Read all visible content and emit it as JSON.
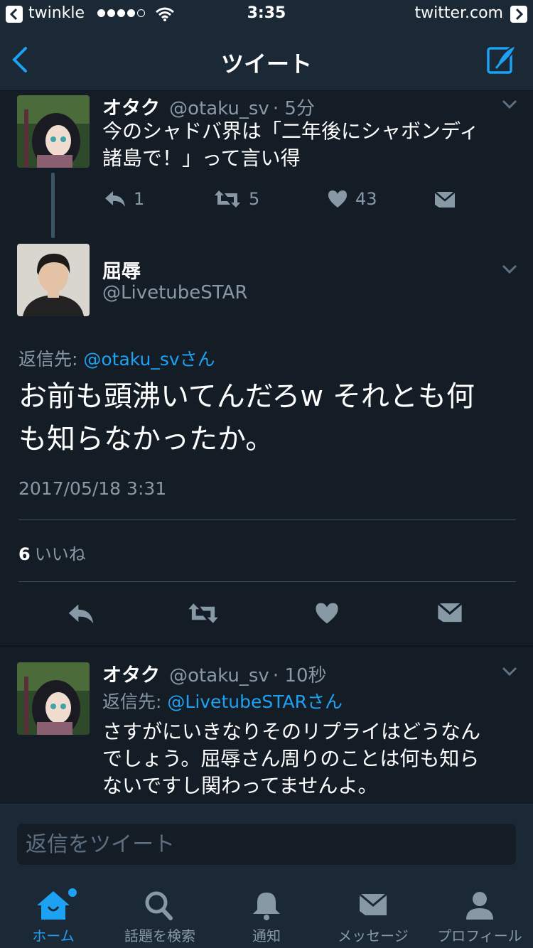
{
  "status_bar": {
    "app": "twinkle",
    "time": "3:35",
    "host": "twitter.com"
  },
  "nav": {
    "title": "ツイート"
  },
  "thread_tweet": {
    "name": "オタク",
    "handle": "@otaku_sv",
    "time": "· 5分",
    "text_line1": "今のシャドバ界は「二年後にシャボンディ",
    "text_line2": "諸島で！」って言い得",
    "reply_count": "1",
    "retweet_count": "5",
    "like_count": "43"
  },
  "main_tweet": {
    "name": "屈辱",
    "handle": "@LivetubeSTAR",
    "reply_to_label": "返信先:",
    "reply_to_link": "@otaku_svさん",
    "text_line1": "お前も頭沸いてんだろw それとも何",
    "text_line2": "も知らなかったか。",
    "timestamp": "2017/05/18 3:31",
    "likes_count": "6",
    "likes_label": "いいね"
  },
  "reply_tweet": {
    "name": "オタク",
    "handle": "@otaku_sv",
    "time": "· 10秒",
    "reply_to_label": "返信先:",
    "reply_to_link": "@LivetubeSTARさん",
    "text_line1": "さすがにいきなりそのリプライはどうなん",
    "text_line2": "でしょう。屈辱さん周りのことは何も知ら",
    "text_line3": "ないですし関わってませんよ。"
  },
  "reply_box": {
    "placeholder": "返信をツイート"
  },
  "tabs": [
    {
      "label": "ホーム",
      "icon": "home-icon"
    },
    {
      "label": "話題を検索",
      "icon": "search-icon"
    },
    {
      "label": "通知",
      "icon": "bell-icon"
    },
    {
      "label": "メッセージ",
      "icon": "envelope-icon"
    },
    {
      "label": "プロフィール",
      "icon": "person-icon"
    }
  ],
  "colors": {
    "background": "#141d26",
    "bar": "#1b2836",
    "accent": "#1da1f2",
    "muted": "#8899a6"
  }
}
